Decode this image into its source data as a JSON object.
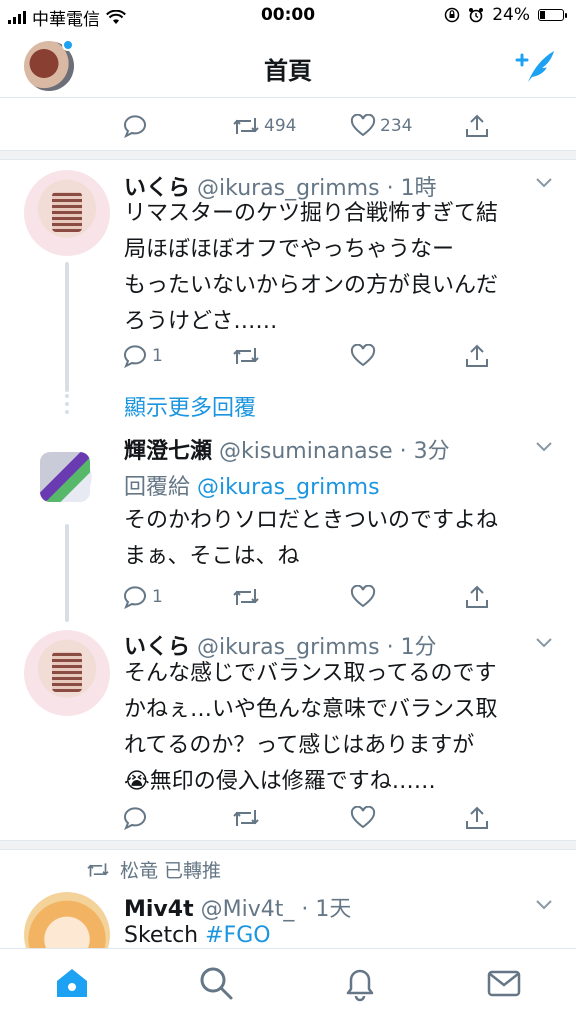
{
  "status_bar": {
    "carrier": "中華電信",
    "time": "00:00",
    "battery": "24%",
    "battery_level": 0.24
  },
  "header": {
    "title": "首頁"
  },
  "top_tweet_actions": {
    "retweets": "494",
    "likes": "234"
  },
  "tweets": [
    {
      "name": "いくら",
      "handle": "@ikuras_grimms",
      "time": "· 1時",
      "lines": [
        "リマスターのケツ掘り合戦怖すぎて結",
        "局ほぼほぼオフでやっちゃうなー",
        "もったいないからオンの方が良いんだ",
        "ろうけどさ……"
      ],
      "replies": "1"
    },
    {
      "name": "輝澄七瀬",
      "handle": "@kisuminanase",
      "time": "· 3分",
      "reply_to_label": "回覆給",
      "reply_to_handle": "@ikuras_grimms",
      "lines": [
        "そのかわりソロだときついのですよね",
        "まぁ、そこは、ね"
      ],
      "replies": "1"
    },
    {
      "name": "いくら",
      "handle": "@ikuras_grimms",
      "time": "· 1分",
      "lines": [
        "そんな感じでバランス取ってるのです",
        "かねぇ…いや色んな意味でバランス取",
        "れてるのか？って感じはありますが",
        "無印の侵入は修羅ですね……"
      ],
      "emoji": "😭"
    },
    {
      "retweeted_by": "松竜 已轉推",
      "name": "Miv4t",
      "handle": "@Miv4t_",
      "time": "· 1天",
      "text_plain": "Sketch ",
      "hashtag": "#FGO"
    }
  ],
  "show_more_replies": "顯示更多回覆",
  "tabs": [
    "home-icon",
    "search-icon",
    "notifications-icon",
    "messages-icon"
  ],
  "colors": {
    "accent": "#1da1f2",
    "muted": "#657786",
    "text": "#14171a"
  }
}
